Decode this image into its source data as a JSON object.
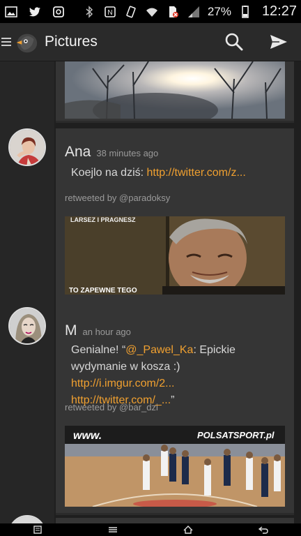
{
  "status_bar": {
    "battery_percent": "27%",
    "time": "12:27",
    "icons": [
      "image-icon",
      "twitter-bird-icon",
      "instagram-icon",
      "bluetooth-icon",
      "nfc-icon",
      "vibrate-icon",
      "wifi-icon",
      "sim-blocked-icon",
      "signal-icon",
      "battery-icon"
    ]
  },
  "action_bar": {
    "title": "Pictures",
    "icons": [
      "menu-icon",
      "app-logo-bird",
      "search-icon",
      "send-icon"
    ]
  },
  "feed": {
    "items": [
      {
        "author": "Ana",
        "time_ago": "38 minutes ago",
        "text_prefix": "Koejlo na dziś: ",
        "link_1": "http://twitter.com/z...",
        "retweeted_by": "retweeted by @paradoksy",
        "image_caption_top": "LARSEZ I PRAGNESZ",
        "image_caption_bottom": "TO ZAPEWNE TEGO"
      },
      {
        "author": "M",
        "time_ago": "an hour ago",
        "text_prefix": "Genialne! “",
        "mention": "@_Pawel_Ka",
        "text_middle": ": Epickie wydymanie w kosza :) ",
        "link_1": "http://i.imgur.com/2...",
        "text_space": " ",
        "link_2": "http://twitter.com/_...",
        "text_suffix": "”",
        "retweeted_by": "retweeted by @bar_dzi",
        "image_caption_top": "www.",
        "image_caption_brand": "POLSATSPORT.pl"
      }
    ]
  },
  "colors": {
    "accent_link": "#f0a030",
    "card_bg": "#353535",
    "rail_bg": "#262626"
  }
}
